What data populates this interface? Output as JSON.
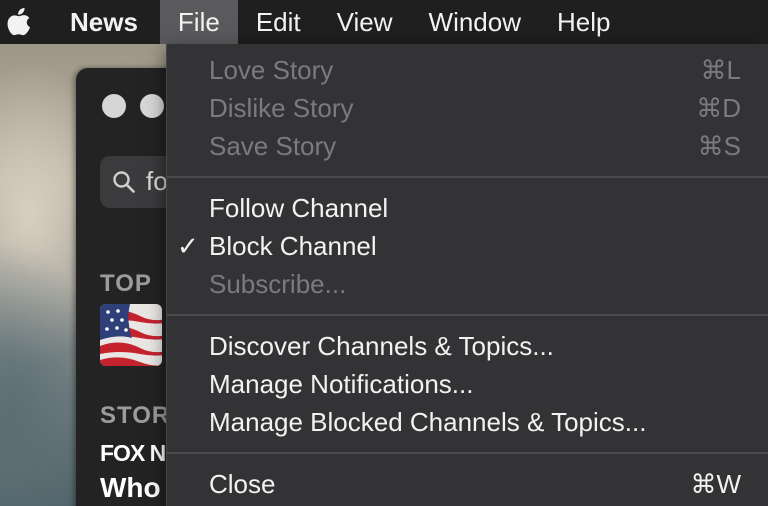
{
  "menubar": {
    "apple_icon": "apple-logo-icon",
    "app_name": "News",
    "menus": [
      "File",
      "Edit",
      "View",
      "Window",
      "Help"
    ],
    "active_menu": "File"
  },
  "file_menu": {
    "items": [
      {
        "label": "Love Story",
        "shortcut": "⌘L",
        "enabled": false,
        "checked": false
      },
      {
        "label": "Dislike Story",
        "shortcut": "⌘D",
        "enabled": false,
        "checked": false
      },
      {
        "label": "Save Story",
        "shortcut": "⌘S",
        "enabled": false,
        "checked": false
      },
      {
        "label": "Follow Channel",
        "shortcut": "",
        "enabled": true,
        "checked": false
      },
      {
        "label": "Block Channel",
        "shortcut": "",
        "enabled": true,
        "checked": true
      },
      {
        "label": "Subscribe...",
        "shortcut": "",
        "enabled": false,
        "checked": false
      },
      {
        "label": "Discover Channels & Topics...",
        "shortcut": "",
        "enabled": true,
        "checked": false
      },
      {
        "label": "Manage Notifications...",
        "shortcut": "",
        "enabled": true,
        "checked": false
      },
      {
        "label": "Manage Blocked Channels & Topics...",
        "shortcut": "",
        "enabled": true,
        "checked": false
      },
      {
        "label": "Close",
        "shortcut": "⌘W",
        "enabled": true,
        "checked": false
      }
    ],
    "checkmark": "✓"
  },
  "news_window": {
    "search_text": "fo",
    "section_top": "TOP",
    "section_stories": "STOR",
    "publisher": "FOX N",
    "headline": "Who"
  },
  "colors": {
    "menubar_bg": "#1f1f1f",
    "menu_bg": "#333335",
    "active_menu_bg": "#5a5a5c",
    "enabled_text": "#f2f2f2",
    "disabled_text": "#7b7b7d"
  }
}
